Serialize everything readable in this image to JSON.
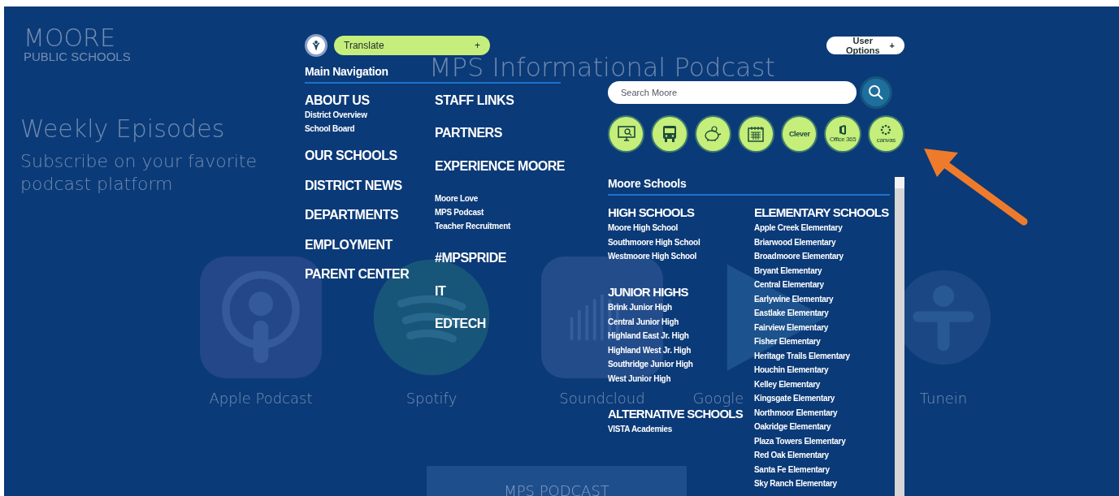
{
  "logo": {
    "name": "MOORE",
    "subtitle": "PUBLIC SCHOOLS"
  },
  "backdrop": {
    "title": "MPS Informational Podcast",
    "subtitle": "Weekly Episodes",
    "tagline": "Subscribe on your favorite podcast platform",
    "platforms": [
      {
        "kind": "podcast",
        "label": "Apple Podcast"
      },
      {
        "kind": "spotify",
        "label": "Spotify"
      },
      {
        "kind": "soundcloud",
        "label": "Soundcloud"
      },
      {
        "kind": "play",
        "label": "Google"
      },
      {
        "kind": "tunein",
        "label": "Tunein"
      }
    ],
    "footer_button": "MPS PODCAST"
  },
  "menu": {
    "translate": {
      "label": "Translate",
      "toggle": "+"
    },
    "user_options": {
      "label": "User Options",
      "toggle": "+"
    },
    "main_navigation": {
      "heading": "Main Navigation",
      "columns": [
        [
          {
            "label": "ABOUT US",
            "children": [
              "District Overview",
              "School Board"
            ]
          },
          {
            "label": "OUR SCHOOLS"
          },
          {
            "label": "DISTRICT NEWS"
          },
          {
            "label": "DEPARTMENTS"
          },
          {
            "label": "EMPLOYMENT"
          },
          {
            "label": "PARENT CENTER"
          }
        ],
        [
          {
            "label": "STAFF LINKS"
          },
          {
            "label": "PARTNERS"
          },
          {
            "label": "EXPERIENCE MOORE",
            "children": [
              "Moore Love",
              "MPS Podcast",
              "Teacher Recruitment"
            ]
          },
          {
            "label": "#MPSPRIDE"
          },
          {
            "label": "IT"
          },
          {
            "label": "EDTECH"
          }
        ]
      ]
    },
    "search": {
      "placeholder": "Search Moore"
    },
    "quick_links": [
      {
        "kind": "monitor"
      },
      {
        "kind": "bus"
      },
      {
        "kind": "piggy"
      },
      {
        "kind": "calendar"
      },
      {
        "kind": "clever",
        "label": "Clever"
      },
      {
        "kind": "office",
        "label": "Office 365"
      },
      {
        "kind": "canvas",
        "label": "canvas"
      }
    ],
    "schools": {
      "heading": "Moore Schools",
      "columns": [
        [
          {
            "label": "HIGH SCHOOLS",
            "children": [
              "Moore High School",
              "Southmoore High School",
              "Westmoore High School"
            ]
          },
          {
            "label": "JUNIOR HIGHS",
            "children": [
              "Brink Junior High",
              "Central Junior High",
              "Highland East Jr. High",
              "Highland West Jr. High",
              "Southridge Junior High",
              "West Junior High"
            ]
          },
          {
            "label": "ALTERNATIVE SCHOOLS",
            "children": [
              "VISTA Academies"
            ]
          }
        ],
        [
          {
            "label": "ELEMENTARY SCHOOLS",
            "children": [
              "Apple Creek Elementary",
              "Briarwood Elementary",
              "Broadmoore Elementary",
              "Bryant Elementary",
              "Central Elementary",
              "Earlywine Elementary",
              "Eastlake Elementary",
              "Fairview Elementary",
              "Fisher Elementary",
              "Heritage Trails Elementary",
              "Houchin Elementary",
              "Kelley Elementary",
              "Kingsgate Elementary",
              "Northmoor Elementary",
              "Oakridge Elementary",
              "Plaza Towers Elementary",
              "Red Oak Elementary",
              "Santa Fe Elementary",
              "Sky Ranch Elementary"
            ]
          }
        ]
      ]
    }
  }
}
